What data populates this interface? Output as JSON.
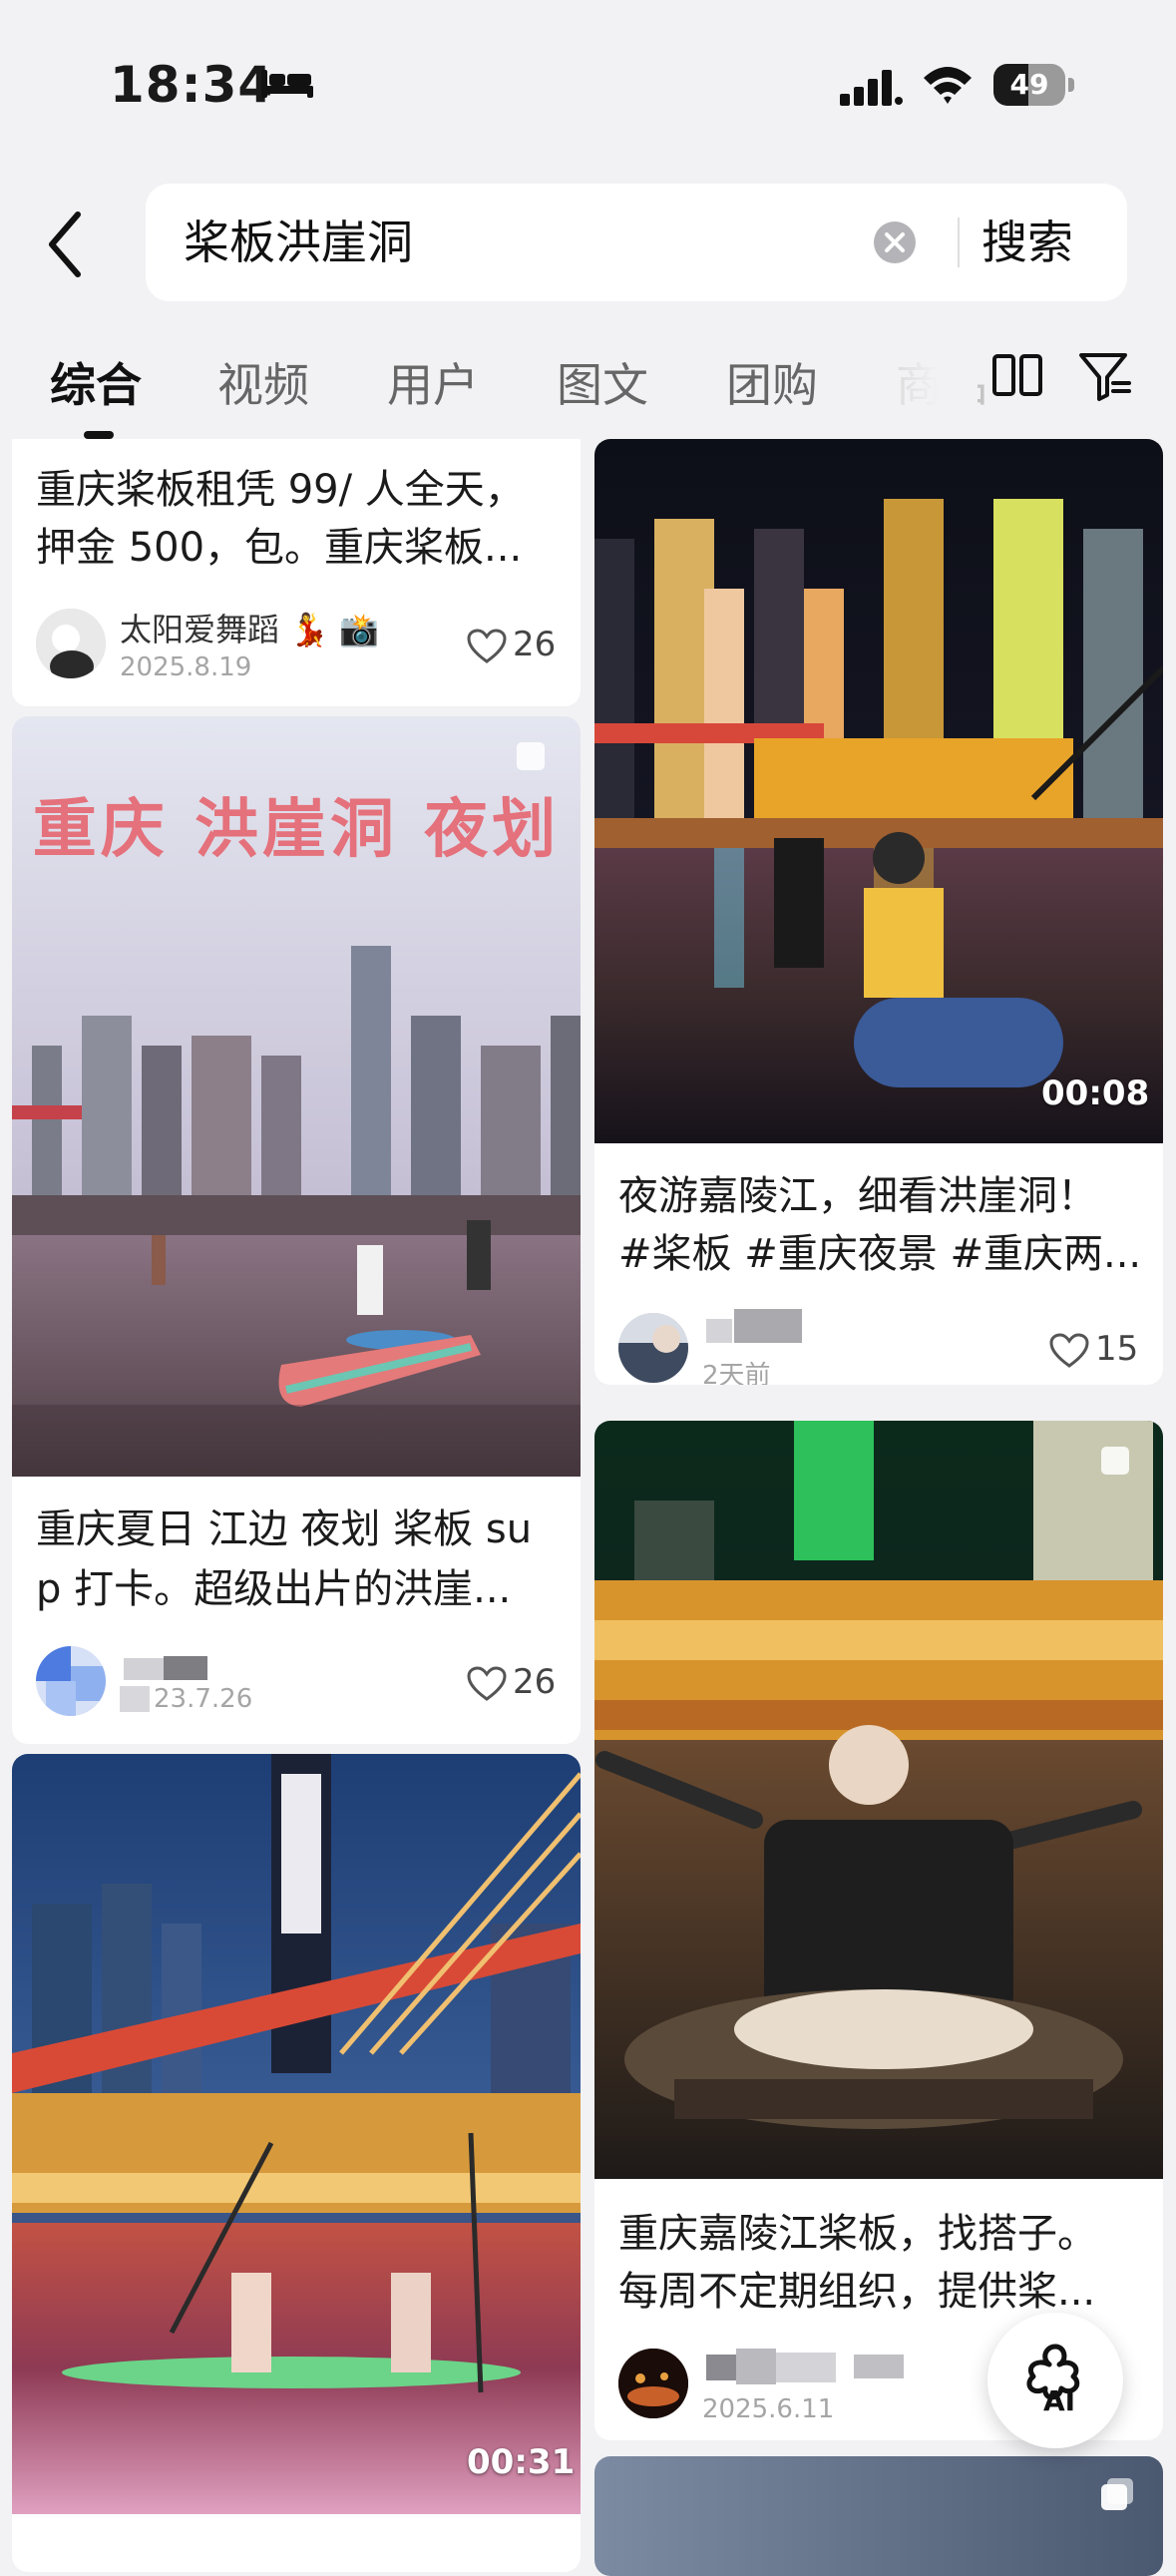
{
  "status_bar": {
    "time": "18:34",
    "battery": "49"
  },
  "search": {
    "query": "桨板洪崖洞",
    "button": "搜索"
  },
  "tabs": [
    "综合",
    "视频",
    "用户",
    "图文",
    "团购",
    "商品"
  ],
  "cards": {
    "c1": {
      "title_line1": "重庆桨板租凭 99/ 人全天，",
      "title_line2": "押金 500，包。重庆桨板...",
      "author": "太阳爱舞蹈 💃 📸",
      "date": "2025.8.19",
      "likes": "26"
    },
    "c2": {
      "banner": "重庆 洪崖洞 夜划",
      "title_line1": "重庆夏日 江边 夜划 桨板 su",
      "title_line2": "p 打卡。超级出片的洪崖...",
      "date": "23.7.26",
      "likes": "26"
    },
    "c3": {
      "duration": "00:31"
    },
    "c4": {
      "duration": "00:08",
      "title_line1": "夜游嘉陵江，细看洪崖洞！",
      "title_line2": "#桨板 #重庆夜景 #重庆两...",
      "date": "2天前",
      "likes": "15"
    },
    "c5": {
      "title_line1": "重庆嘉陵江桨板，找搭子。",
      "title_line2": "每周不定期组织，提供桨...",
      "date": "2025.6.11"
    }
  },
  "fab": {
    "label": "AI"
  }
}
